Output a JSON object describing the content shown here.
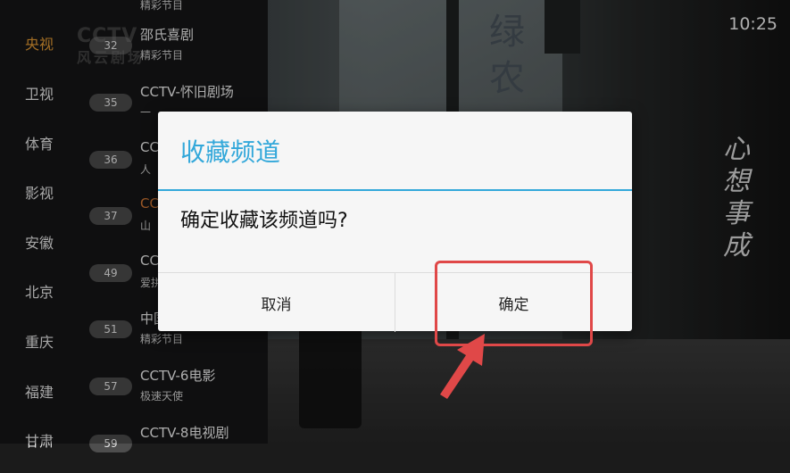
{
  "clock": "10:25",
  "categories": [
    {
      "label": "央视",
      "active": true
    },
    {
      "label": "卫视"
    },
    {
      "label": "体育"
    },
    {
      "label": "影视"
    },
    {
      "label": "安徽"
    },
    {
      "label": "北京"
    },
    {
      "label": "重庆"
    },
    {
      "label": "福建"
    },
    {
      "label": "甘肃"
    }
  ],
  "watermark": {
    "brand": "CCTV",
    "sub": "风云剧场"
  },
  "channels": [
    {
      "number": "",
      "name": "",
      "program": "精彩节目"
    },
    {
      "number": "32",
      "name": "邵氏喜剧",
      "program": "精彩节目"
    },
    {
      "number": "35",
      "name": "CCTV-怀旧剧场",
      "program": "一"
    },
    {
      "number": "36",
      "name": "CC",
      "program": "人"
    },
    {
      "number": "37",
      "name": "CC",
      "program": "山"
    },
    {
      "number": "49",
      "name": "CCTV",
      "program": "爱拼"
    },
    {
      "number": "51",
      "name": "中国",
      "program": "精彩节目"
    },
    {
      "number": "57",
      "name": "CCTV-6电影",
      "program": "极速天使"
    },
    {
      "number": "59",
      "name": "CCTV-8电视剧",
      "program": ""
    }
  ],
  "background": {
    "calligraphy": "心想事成",
    "sign": "绿农"
  },
  "dialog": {
    "title": "收藏频道",
    "message": "确定收藏该频道吗?",
    "cancel_label": "取消",
    "confirm_label": "确定",
    "accent_color": "#33a8da"
  },
  "annotation": {
    "color": "#e04848"
  }
}
